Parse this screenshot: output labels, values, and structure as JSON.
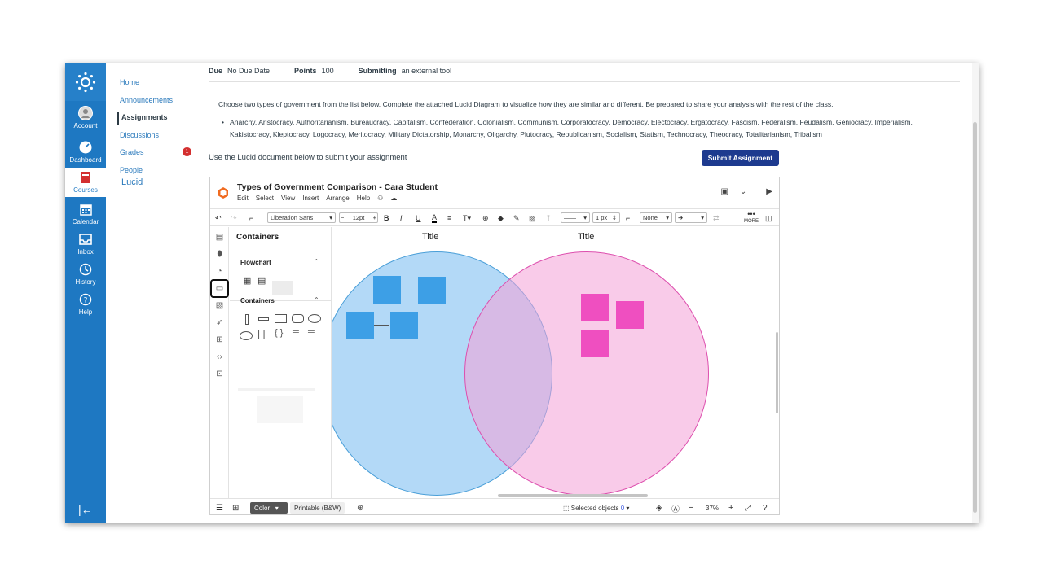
{
  "global_nav": {
    "items": [
      {
        "label": "Account",
        "icon": "account-icon"
      },
      {
        "label": "Dashboard",
        "icon": "dashboard-icon"
      },
      {
        "label": "Courses",
        "icon": "courses-icon"
      },
      {
        "label": "Calendar",
        "icon": "calendar-icon"
      },
      {
        "label": "Inbox",
        "icon": "inbox-icon"
      },
      {
        "label": "History",
        "icon": "history-icon"
      },
      {
        "label": "Help",
        "icon": "help-icon"
      }
    ],
    "collapse_glyph": "|←"
  },
  "course_nav": {
    "items": [
      "Home",
      "Announcements",
      "Assignments",
      "Discussions",
      "Grades",
      "People",
      "Lucid"
    ],
    "grades_badge": "1"
  },
  "assignment": {
    "due_label": "Due",
    "due_value": "No Due Date",
    "points_label": "Points",
    "points_value": "100",
    "submitting_label": "Submitting",
    "submitting_value": "an external tool",
    "description": "Choose two types of government from the list below.  Complete the attached Lucid Diagram to visualize how they are similar and different.  Be prepared to share your analysis with the rest of the class.",
    "governments": "Anarchy, Aristocracy, Authoritarianism, Bureaucracy, Capitalism, Confederation, Colonialism, Communism, Corporatocracy, Democracy, Electocracy, Ergatocracy, Fascism, Federalism, Feudalism, Geniocracy, Imperialism, Kakistocracy, Kleptocracy, Logocracy, Meritocracy, Military Dictatorship, Monarchy, Oligarchy, Plutocracy, Republicanism, Socialism, Statism, Technocracy, Theocracy, Totalitarianism, Tribalism",
    "use_doc": "Use the Lucid document below to submit your assignment",
    "submit_label": "Submit Assignment"
  },
  "lucid": {
    "doc_title": "Types of Government Comparison - Cara Student",
    "menu": [
      "Edit",
      "Select",
      "View",
      "Insert",
      "Arrange",
      "Help"
    ],
    "font": "Liberation Sans",
    "font_size": "12pt",
    "line_width": "1 px",
    "line_end": "None",
    "more_label": "MORE",
    "panel_title": "Containers",
    "flowchart_label": "Flowchart",
    "containers_label": "Containers",
    "canvas_title_left": "Title",
    "canvas_title_right": "Title",
    "bottom": {
      "color_tab": "Color",
      "printable_tab": "Printable (B&W)",
      "selected_objects": "Selected objects",
      "selected_count": "0",
      "zoom": "37%"
    },
    "colors": {
      "blue_circle": "#b3d9f5",
      "blue_border": "#4a9fd8",
      "pink_circle": "#f9c8e6",
      "pink_border": "#dd4fae",
      "blue_note": "#3d9fe6",
      "pink_note": "#ef4fc0"
    }
  }
}
